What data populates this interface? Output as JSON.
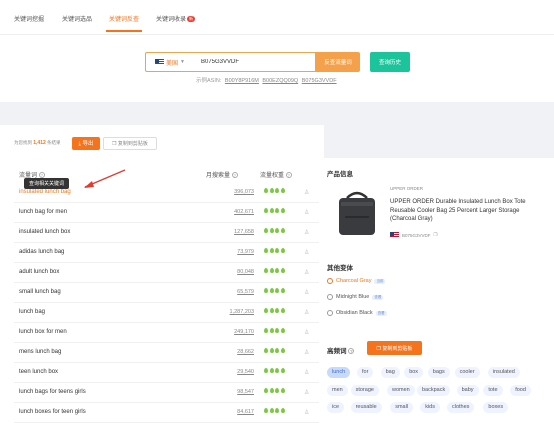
{
  "tabs": [
    {
      "label": "关键词挖掘"
    },
    {
      "label": "关键词选品"
    },
    {
      "label": "关键词反查",
      "active": true
    },
    {
      "label": "关键词收录",
      "badge": "新"
    }
  ],
  "search": {
    "market_label": "美国",
    "asin_value": "B075G3VVDF",
    "search_button": "反查流量词",
    "history_button": "查询历史",
    "example_label": "示例ASIN:",
    "examples": [
      "B00Y8P916M",
      "B00EZQQ09Q",
      "B075G3VVDF"
    ]
  },
  "summary": {
    "prefix": "为您找到",
    "count": "1,412",
    "suffix": "条结果",
    "export_button": "导出",
    "copy_button": "复制到剪贴板"
  },
  "table": {
    "headers": {
      "keyword": "流量词",
      "volume": "月搜索量",
      "weight": "流量权重"
    },
    "tooltip": "查询相关关键词",
    "rows": [
      {
        "keyword": "insulated lunch bag",
        "volume": "396,073",
        "highlight": true
      },
      {
        "keyword": "lunch bag for men",
        "volume": "402,671"
      },
      {
        "keyword": "insulated lunch box",
        "volume": "127,658"
      },
      {
        "keyword": "adidas lunch bag",
        "volume": "73,979"
      },
      {
        "keyword": "adult lunch box",
        "volume": "80,048"
      },
      {
        "keyword": "small lunch bag",
        "volume": "65,579"
      },
      {
        "keyword": "lunch bag",
        "volume": "1,287,203"
      },
      {
        "keyword": "lunch box for men",
        "volume": "249,170"
      },
      {
        "keyword": "mens lunch bag",
        "volume": "28,662"
      },
      {
        "keyword": "teen lunch box",
        "volume": "29,540"
      },
      {
        "keyword": "lunch bags for teens girls",
        "volume": "98,547"
      },
      {
        "keyword": "lunch boxes for teen girls",
        "volume": "84,617"
      }
    ]
  },
  "product": {
    "section_title": "产品信息",
    "brand": "UPPER ORDER",
    "title": "UPPER ORDER Durable Insulated Lunch Box Tote Reusable Cooler Bag 25 Percent Larger Storage (Charcoal Gray)",
    "asin": "B075G3VVDF"
  },
  "variants": {
    "section_title": "其他变体",
    "items": [
      {
        "label": "Charcoal Gray",
        "tag": "当前",
        "selected": true
      },
      {
        "label": "Midnight Blue",
        "tag": "查看"
      },
      {
        "label": "Obsidian Black",
        "tag": "查看"
      }
    ]
  },
  "frequent": {
    "section_title": "高频词",
    "copy_button": "复制到剪贴板",
    "words": [
      "lunch",
      "for",
      "bag",
      "box",
      "bags",
      "cooler",
      "insulated",
      "men",
      "storage",
      "women",
      "backpack",
      "baby",
      "tote",
      "food",
      "ice",
      "reusable",
      "small",
      "kids",
      "clothes",
      "boxes"
    ]
  },
  "colors": {
    "accent": "#f5731d",
    "green": "#1cc49b",
    "drop": "#7bc943"
  }
}
